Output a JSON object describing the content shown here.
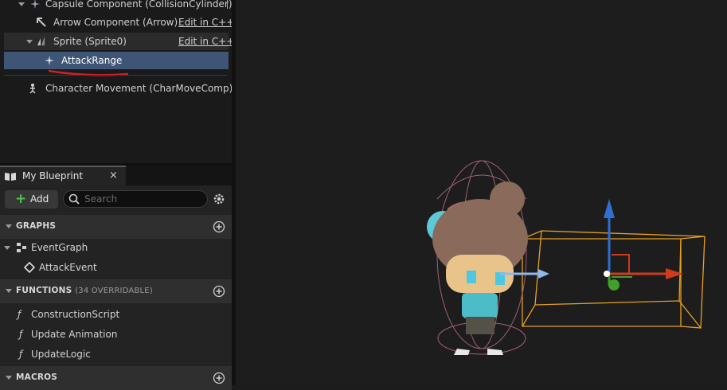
{
  "components": {
    "capsule": "Capsule Component (CollisionCylinder)",
    "arrow": "Arrow Component (Arrow)",
    "arrow_edit": "Edit in C++",
    "sprite": "Sprite (Sprite0)",
    "sprite_edit": "Edit in C++",
    "attack_range": "AttackRange",
    "char_movement": "Character Movement (CharMoveComp)"
  },
  "my_blueprint": {
    "tab_title": "My Blueprint",
    "close_glyph": "×",
    "add_label": "Add",
    "search_placeholder": "Search",
    "graphs_header": "GRAPHS",
    "event_graph": "EventGraph",
    "attack_event": "AttackEvent",
    "functions_header": "FUNCTIONS",
    "functions_sub": "(34 OVERRIDABLE)",
    "functions": [
      "ConstructionScript",
      "Update Animation",
      "UpdateLogic"
    ],
    "macros_header": "MACROS"
  },
  "colors": {
    "selected_row": "#3f5575",
    "bounds_box": "#e8a020",
    "capsule_wire": "#a06070",
    "gizmo_z": "#2f6fd0",
    "gizmo_x": "#d03a20",
    "gizmo_y": "#3fa02a"
  },
  "icons": [
    "capsule-icon",
    "arrow-icon",
    "sprite-icon",
    "attack-range-icon",
    "character-movement-icon",
    "book-icon",
    "search-icon",
    "gear-icon",
    "event-graph-icon",
    "event-icon",
    "function-icon"
  ]
}
